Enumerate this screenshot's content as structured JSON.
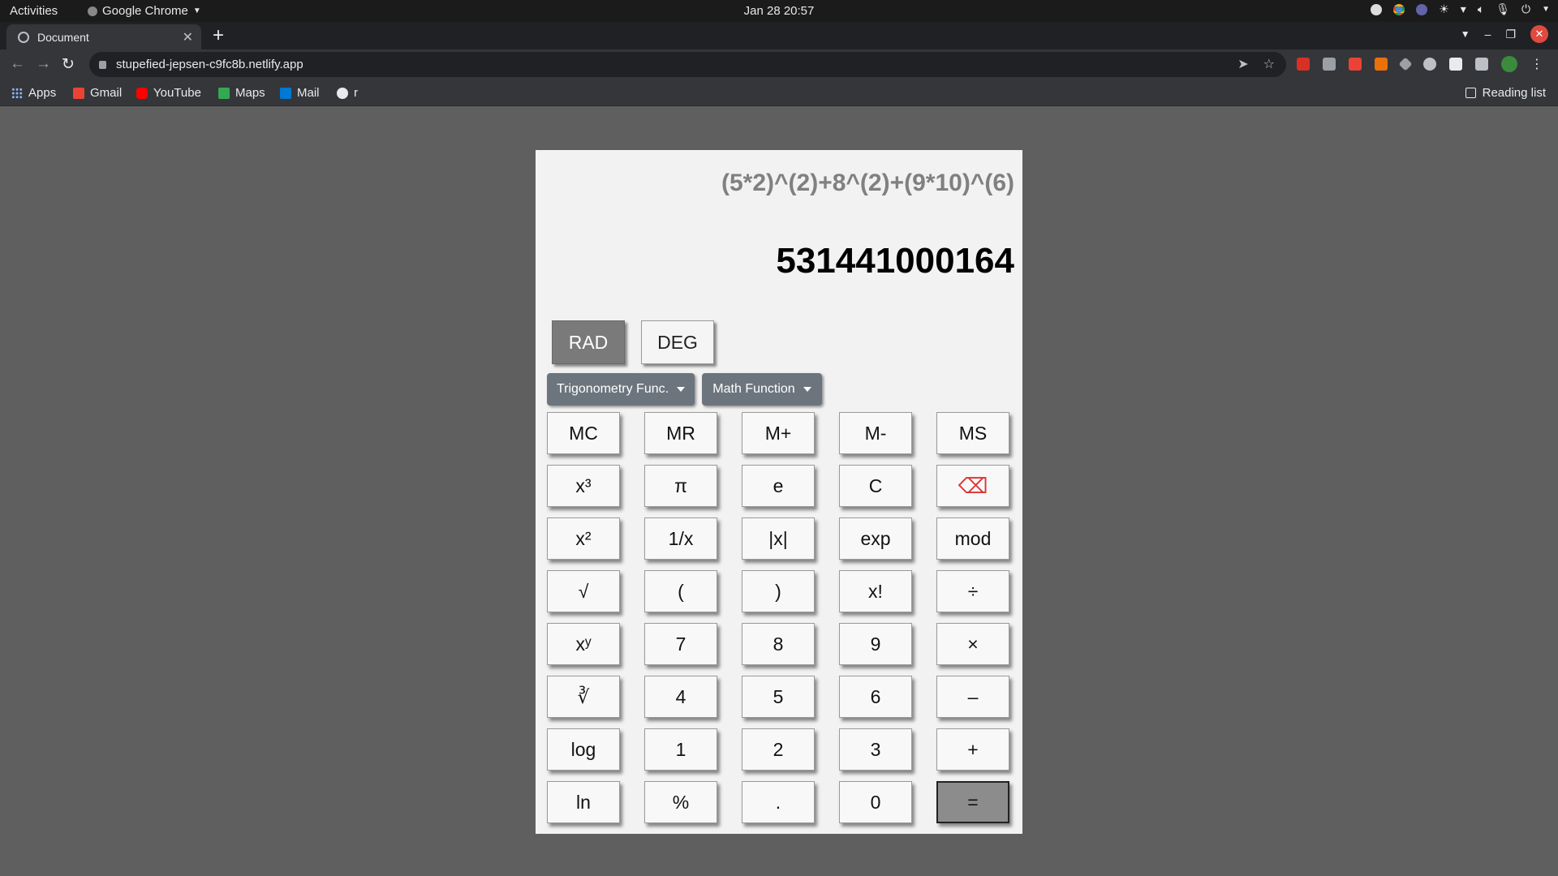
{
  "topbar": {
    "activities": "Activities",
    "app_name": "Google Chrome",
    "clock": "Jan 28  20:57"
  },
  "browser": {
    "tab_title": "Document",
    "url": "stupefied-jepsen-c9fc8b.netlify.app",
    "bookmarks": [
      "Apps",
      "Gmail",
      "YouTube",
      "Maps",
      "Mail",
      "r"
    ],
    "reading_list": "Reading list"
  },
  "calculator": {
    "expression": "(5*2)^(2)+8^(2)+(9*10)^(6)",
    "result": "531441000164",
    "modes": [
      "RAD",
      "DEG"
    ],
    "active_mode": "RAD",
    "dropdowns": [
      "Trigonometry Func.",
      "Math Function"
    ],
    "rows": [
      [
        "MC",
        "MR",
        "M+",
        "M-",
        "MS"
      ],
      [
        "x³",
        "π",
        "e",
        "C",
        "⌫"
      ],
      [
        "x²",
        "1/x",
        "|x|",
        "exp",
        "mod"
      ],
      [
        "√",
        "(",
        ")",
        "x!",
        "÷"
      ],
      [
        "xʸ",
        "7",
        "8",
        "9",
        "×"
      ],
      [
        "∛",
        "4",
        "5",
        "6",
        "–"
      ],
      [
        "log",
        "1",
        "2",
        "3",
        "+"
      ],
      [
        "ln",
        "%",
        ".",
        "0",
        "="
      ]
    ]
  }
}
